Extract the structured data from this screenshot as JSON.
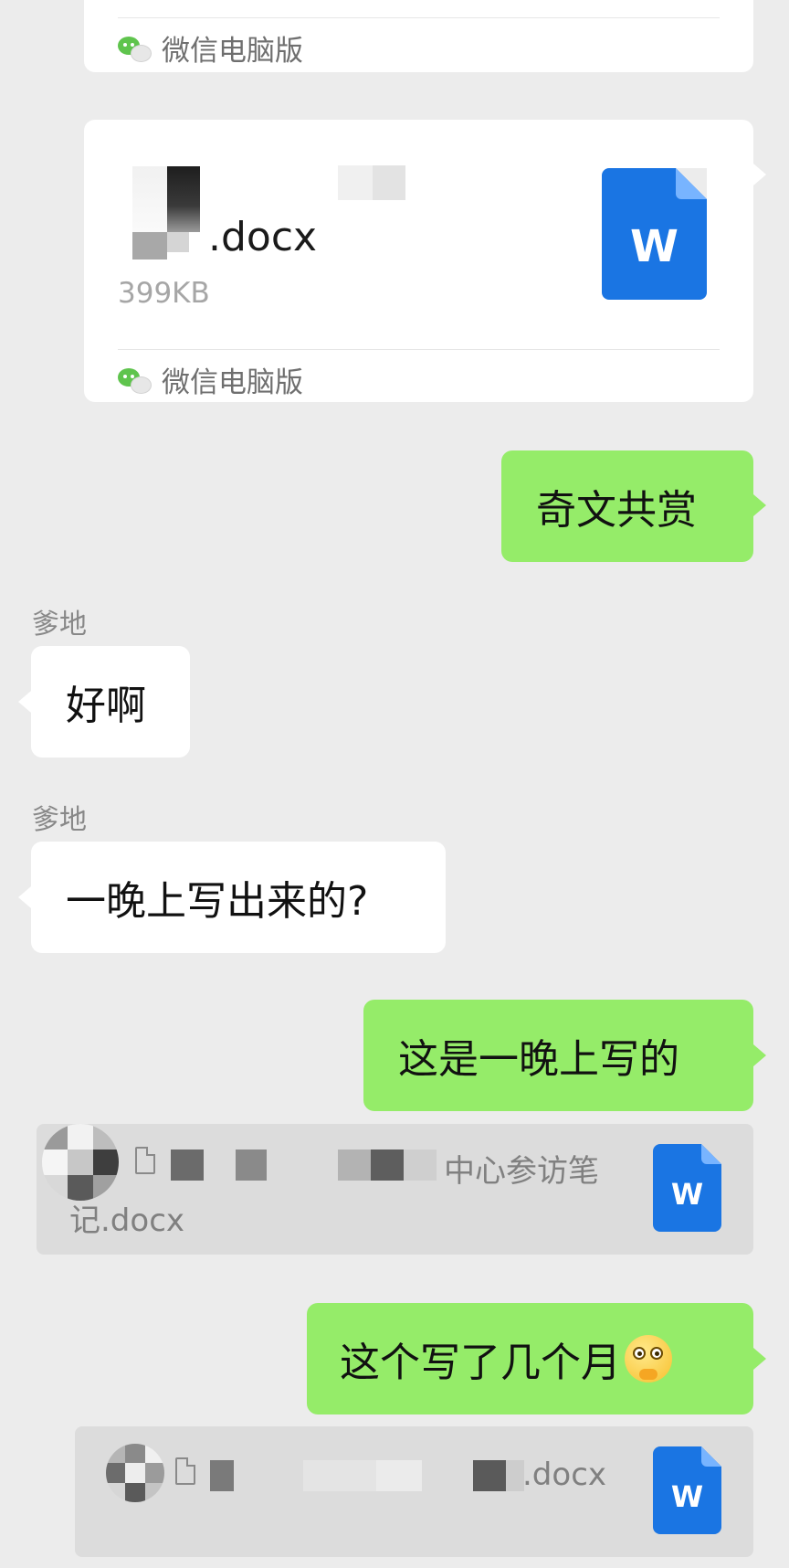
{
  "file_card_top": {
    "source_label": "微信电脑版"
  },
  "file_card_main": {
    "file_name_suffix": ".docx",
    "file_size": "399KB",
    "source_label": "微信电脑版",
    "icon_letter": "W"
  },
  "messages": [
    {
      "direction": "out",
      "text": "奇文共赏"
    },
    {
      "direction": "in",
      "sender": "爹地",
      "text": "好啊"
    },
    {
      "direction": "in",
      "sender": "爹地",
      "text": "一晚上写出来的?"
    },
    {
      "direction": "out",
      "text": "这是一晚上写的"
    },
    {
      "direction": "out",
      "text": "这个写了几个月"
    }
  ],
  "quote_1": {
    "visible_text_line1": "中心参访笔",
    "visible_text_line2": "记.docx",
    "icon_letter": "W"
  },
  "quote_2": {
    "visible_text": ".docx",
    "icon_letter": "W"
  },
  "colors": {
    "background": "#ececec",
    "outgoing_bubble": "#95ec69",
    "incoming_bubble": "#ffffff",
    "word_blue": "#1a75e3",
    "wechat_green": "#5fc44d"
  },
  "icons": [
    "wechat-logo-icon",
    "word-file-icon",
    "document-icon",
    "thinking-emoji-icon"
  ]
}
